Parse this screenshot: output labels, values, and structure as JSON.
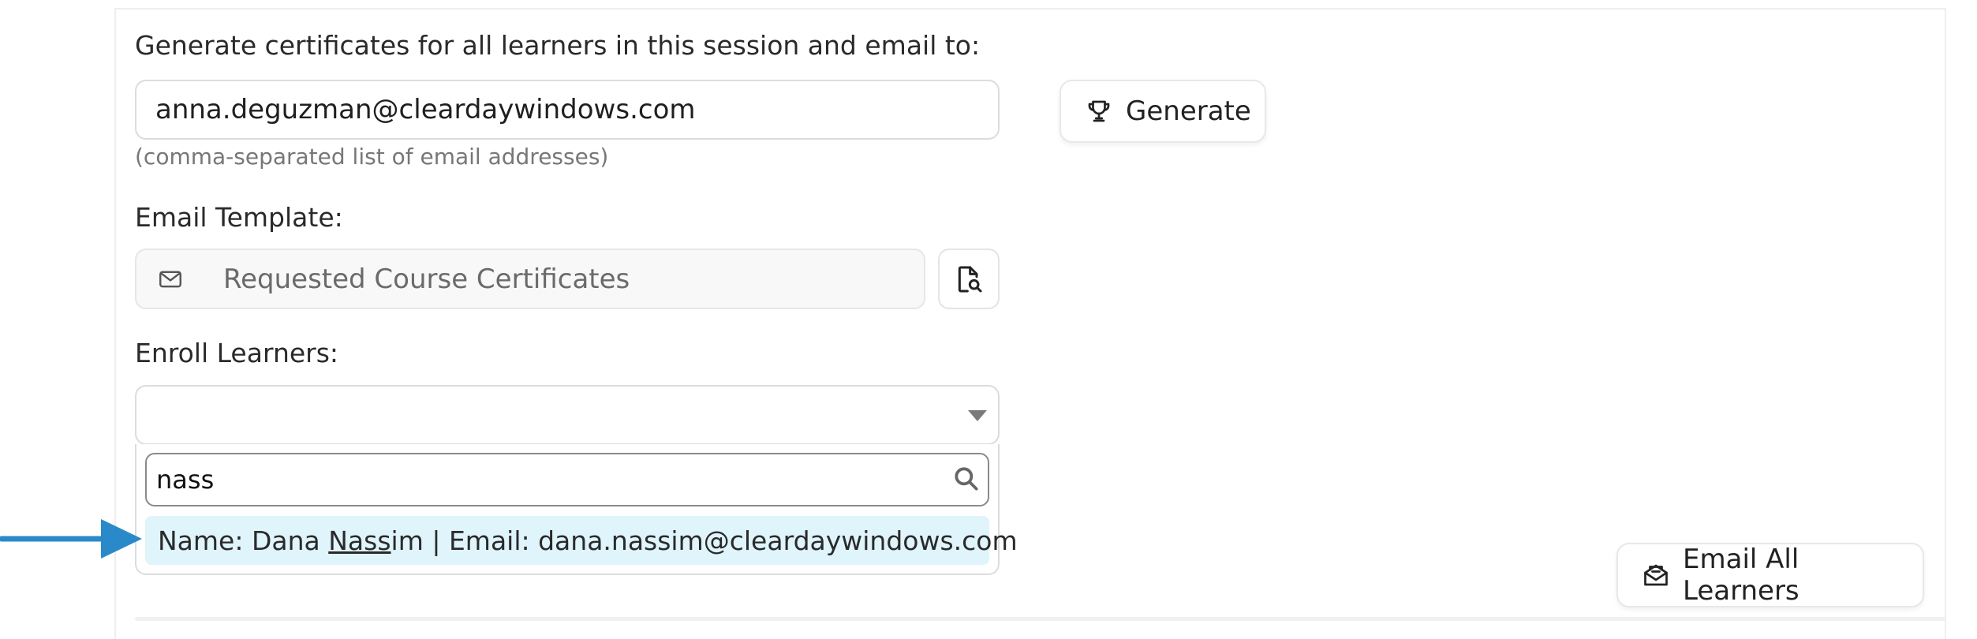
{
  "certificates": {
    "heading": "Generate certificates for all learners in this session and email to:",
    "email_value": "anna.deguzman@cleardaywindows.com",
    "hint": "(comma-separated list of email addresses)",
    "generate_label": "Generate"
  },
  "template": {
    "label": "Email Template:",
    "value": "Requested Course Certificates"
  },
  "enroll": {
    "label": "Enroll Learners:",
    "search_value": "nass",
    "option": {
      "prefix": "Name: Dana ",
      "match": "Nass",
      "suffix": "im | Email: dana.nassim@cleardaywindows.com"
    }
  },
  "actions": {
    "email_all_label": "Email All Learners"
  },
  "icons": {
    "generate": "trophy-icon",
    "template": "envelope-icon",
    "preview": "document-search-icon",
    "search": "magnifier-icon",
    "email_all": "mail-open-icon",
    "pointer": "arrow-right-icon"
  },
  "colors": {
    "highlight": "#dff4fb",
    "arrow": "#2a8ac9"
  }
}
